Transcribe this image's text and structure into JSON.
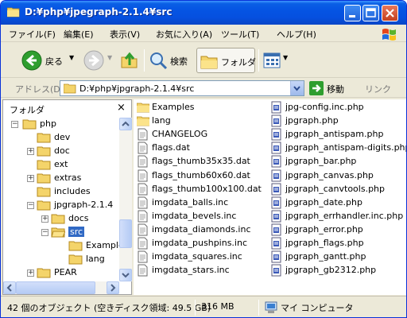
{
  "window": {
    "title": "D:¥php¥jpegraph-2.1.4¥src"
  },
  "menu": [
    "ファイル(F)",
    "編集(E)",
    "表示(V)",
    "お気に入り(A)",
    "ツール(T)",
    "ヘルプ(H)"
  ],
  "toolbar": {
    "back": "戻る",
    "search": "検索",
    "folders": "フォルダ"
  },
  "address": {
    "label": "アドレス(D)",
    "value": "D:¥php¥jpgraph-2.1.4¥src",
    "go": "移動",
    "links": "リンク"
  },
  "folder_pane": {
    "title": "フォルダ",
    "close": "×",
    "tree": [
      {
        "label": "php",
        "expander": "−"
      },
      {
        "label": "dev",
        "expander": ""
      },
      {
        "label": "doc",
        "expander": "+"
      },
      {
        "label": "ext",
        "expander": ""
      },
      {
        "label": "extras",
        "expander": "+"
      },
      {
        "label": "includes",
        "expander": ""
      },
      {
        "label": "jpgraph-2.1.4",
        "expander": "−"
      },
      {
        "label": "docs",
        "expander": "+"
      },
      {
        "label": "src",
        "expander": "−"
      },
      {
        "label": "Examples",
        "expander": ""
      },
      {
        "label": "lang",
        "expander": ""
      },
      {
        "label": "PEAR",
        "expander": "+"
      }
    ]
  },
  "files": {
    "column1": [
      {
        "name": "Examples",
        "type": "folder"
      },
      {
        "name": "lang",
        "type": "folder"
      },
      {
        "name": "CHANGELOG",
        "type": "doc"
      },
      {
        "name": "flags.dat",
        "type": "doc"
      },
      {
        "name": "flags_thumb35x35.dat",
        "type": "doc"
      },
      {
        "name": "flags_thumb60x60.dat",
        "type": "doc"
      },
      {
        "name": "flags_thumb100x100.dat",
        "type": "doc"
      },
      {
        "name": "imgdata_balls.inc",
        "type": "doc"
      },
      {
        "name": "imgdata_bevels.inc",
        "type": "doc"
      },
      {
        "name": "imgdata_diamonds.inc",
        "type": "doc"
      },
      {
        "name": "imgdata_pushpins.inc",
        "type": "doc"
      },
      {
        "name": "imgdata_squares.inc",
        "type": "doc"
      },
      {
        "name": "imgdata_stars.inc",
        "type": "doc"
      }
    ],
    "column2": [
      {
        "name": "jpg-config.inc.php",
        "type": "php"
      },
      {
        "name": "jpgraph.php",
        "type": "php"
      },
      {
        "name": "jpgraph_antispam.php",
        "type": "php"
      },
      {
        "name": "jpgraph_antispam-digits.php",
        "type": "php"
      },
      {
        "name": "jpgraph_bar.php",
        "type": "php"
      },
      {
        "name": "jpgraph_canvas.php",
        "type": "php"
      },
      {
        "name": "jpgraph_canvtools.php",
        "type": "php"
      },
      {
        "name": "jpgraph_date.php",
        "type": "php"
      },
      {
        "name": "jpgraph_errhandler.inc.php",
        "type": "php"
      },
      {
        "name": "jpgraph_error.php",
        "type": "php"
      },
      {
        "name": "jpgraph_flags.php",
        "type": "php"
      },
      {
        "name": "jpgraph_gantt.php",
        "type": "php"
      },
      {
        "name": "jpgraph_gb2312.php",
        "type": "php"
      }
    ]
  },
  "status": {
    "objects": "42 個のオブジェクト (空きディスク領域: 49.5 GB)",
    "size": "316 MB",
    "location": "マイ コンピュータ"
  },
  "colors": {
    "title_bar": "#0554e3",
    "selection": "#316ac5",
    "folder": "#f4d46a"
  }
}
